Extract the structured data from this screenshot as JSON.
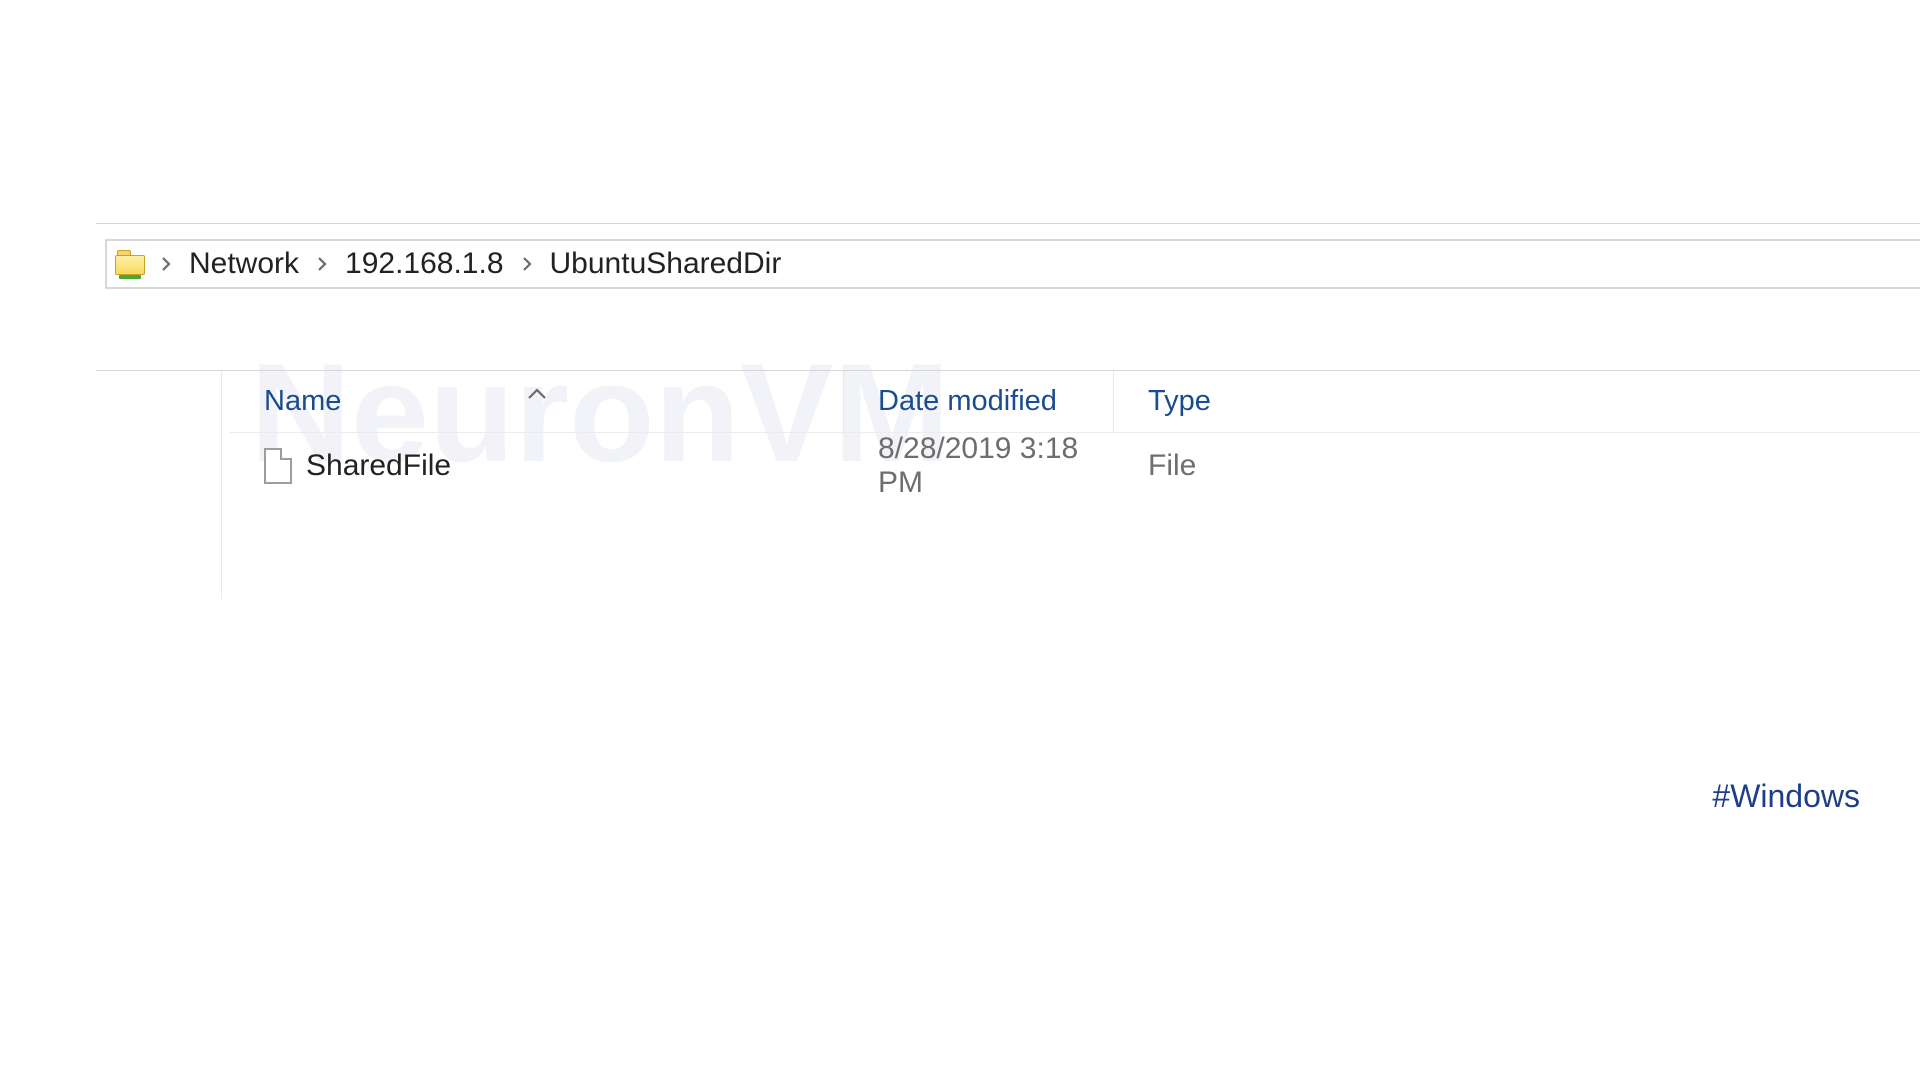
{
  "watermark": "NeuronVM",
  "breadcrumb": {
    "items": [
      "Network",
      "192.168.1.8",
      "UbuntuSharedDir"
    ]
  },
  "columns": {
    "name": "Name",
    "date": "Date modified",
    "type": "Type"
  },
  "files": [
    {
      "name": "SharedFile",
      "date": "8/28/2019 3:18 PM",
      "type": "File"
    }
  ],
  "hashtag": "#Windows"
}
